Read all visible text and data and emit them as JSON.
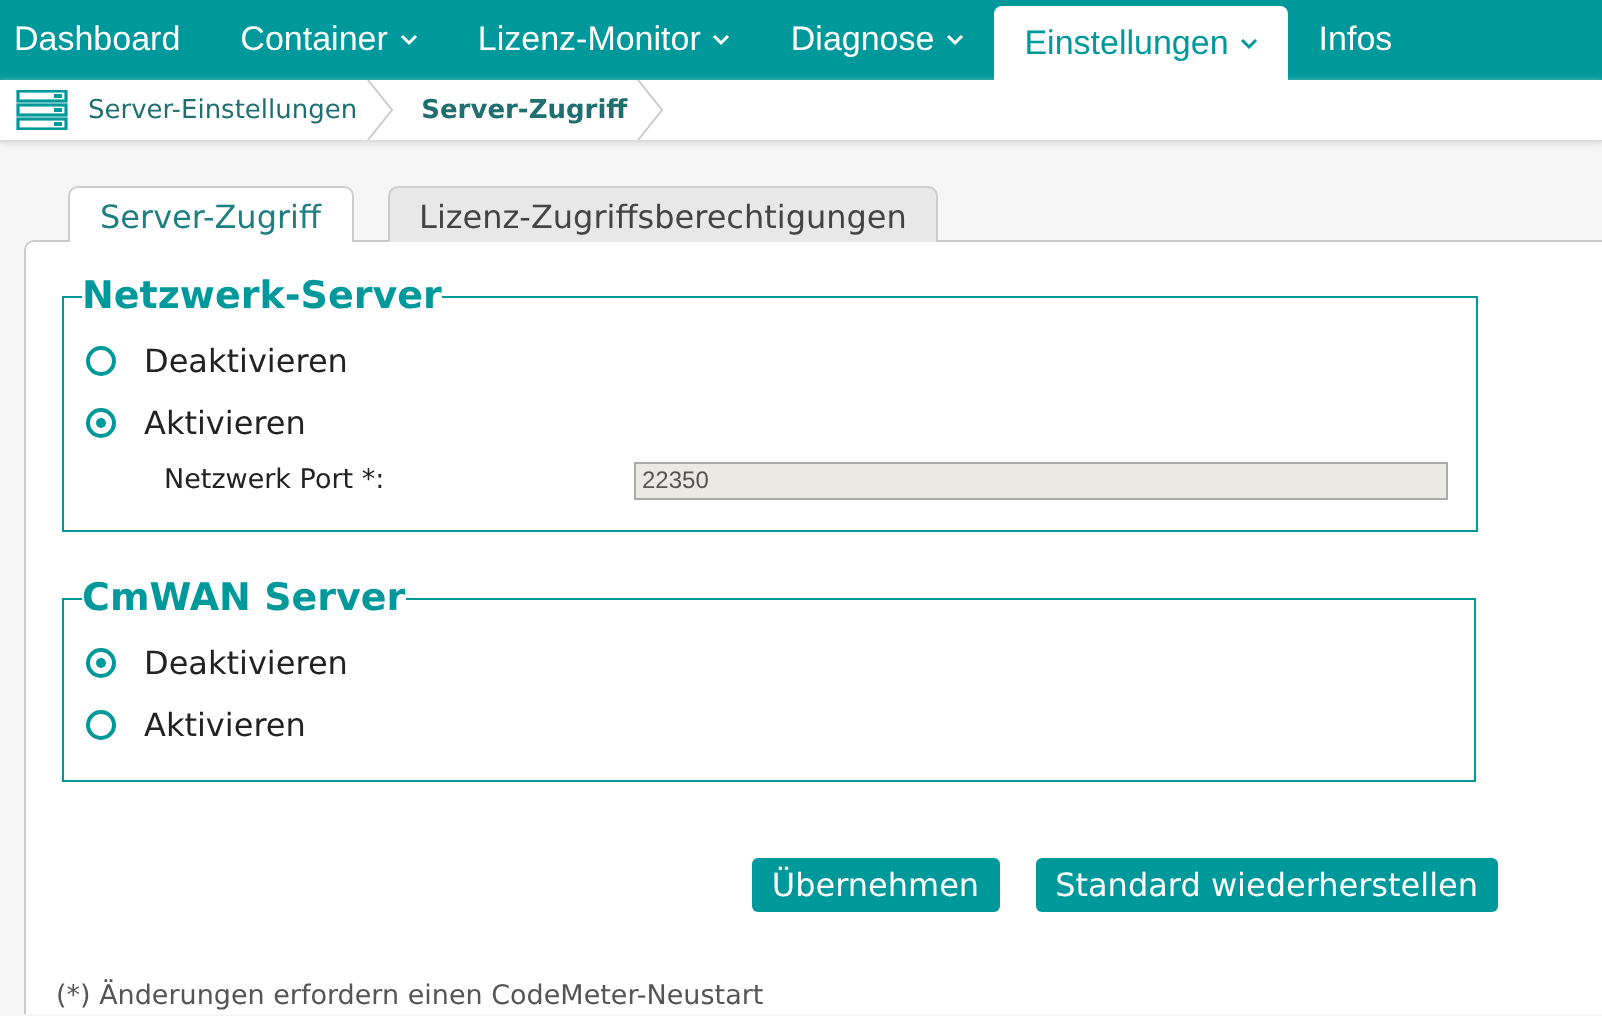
{
  "nav": [
    {
      "label": "Dashboard",
      "dropdown": false,
      "selected": false
    },
    {
      "label": "Container",
      "dropdown": true,
      "selected": false
    },
    {
      "label": "Lizenz-Monitor",
      "dropdown": true,
      "selected": false
    },
    {
      "label": "Diagnose",
      "dropdown": true,
      "selected": false
    },
    {
      "label": "Einstellungen",
      "dropdown": true,
      "selected": true
    },
    {
      "label": "Infos",
      "dropdown": false,
      "selected": false
    }
  ],
  "breadcrumb": [
    {
      "label": "Server-Einstellungen",
      "selected": false
    },
    {
      "label": "Server-Zugriff",
      "selected": true
    }
  ],
  "tabs": [
    {
      "label": "Server-Zugriff",
      "selected": true
    },
    {
      "label": "Lizenz-Zugriffsberechtigungen",
      "selected": false
    }
  ],
  "sections": [
    {
      "title": "Netzwerk-Server",
      "options": [
        {
          "label": "Deaktivieren",
          "selected": false
        },
        {
          "label": "Aktivieren",
          "selected": true
        }
      ],
      "field": {
        "label": "Netzwerk Port *:",
        "value": "22350",
        "disabled": true
      }
    },
    {
      "title": "CmWAN Server",
      "options": [
        {
          "label": "Deaktivieren",
          "selected": true
        },
        {
          "label": "Aktivieren",
          "selected": false
        }
      ]
    }
  ],
  "buttons": [
    "Übernehmen",
    "Standard wiederherstellen"
  ],
  "footnote": "(*) Änderungen erfordern einen CodeMeter-Neustart"
}
